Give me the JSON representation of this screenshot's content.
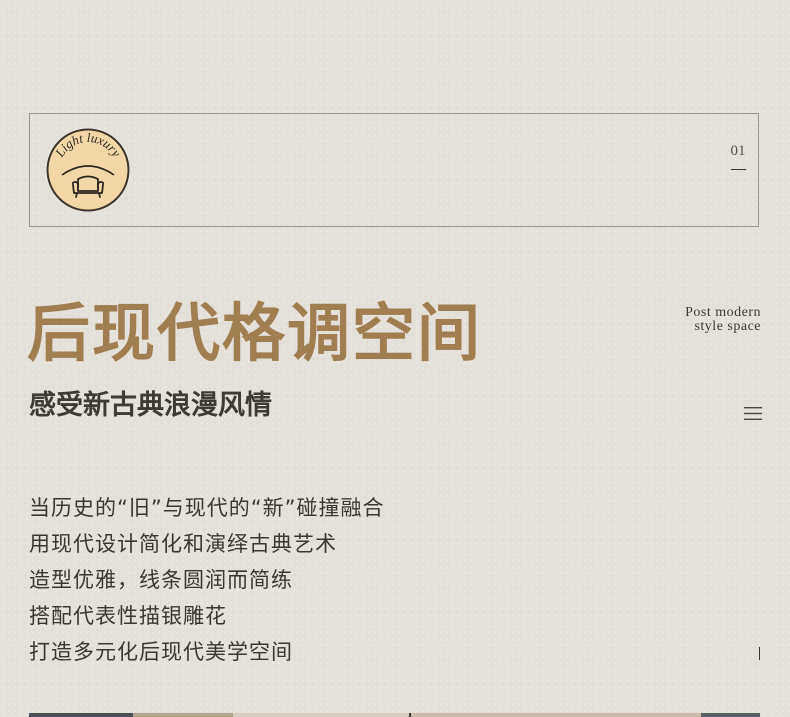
{
  "badge": {
    "text": "Light luxury",
    "icon": "armchair-icon"
  },
  "page_number": "01",
  "title": "后现代格调空间",
  "en_subtitle": {
    "line1": "Post modern",
    "line2": "style space"
  },
  "subtitle": "感受新古典浪漫风情",
  "menu_icon": "menu-icon",
  "body_lines": [
    "当历史的“旧”与现代的“新”碰撞融合",
    "用现代设计简化和演绎古典艺术",
    "造型优雅，线条圆润而简练",
    "搭配代表性描银雕花",
    "打造多元化后现代美学空间"
  ],
  "colors": {
    "background": "#e4e0da",
    "title_gold": "#a07e4f",
    "badge_fill": "#f3d7a6",
    "text_dark": "#3a3733"
  }
}
